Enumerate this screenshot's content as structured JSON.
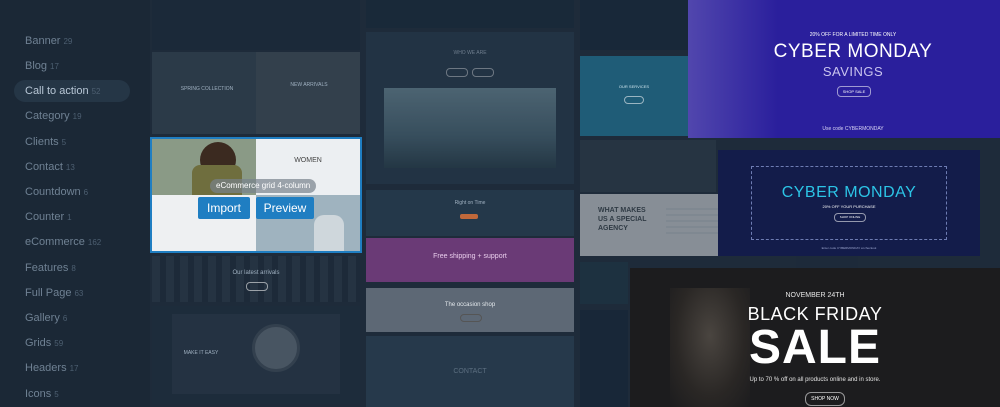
{
  "sidebar": {
    "items": [
      {
        "label": "",
        "count": ""
      },
      {
        "label": "Banner",
        "count": "29"
      },
      {
        "label": "Blog",
        "count": "17"
      },
      {
        "label": "Call to action",
        "count": "52"
      },
      {
        "label": "Category",
        "count": "19"
      },
      {
        "label": "Clients",
        "count": "5"
      },
      {
        "label": "Contact",
        "count": "13"
      },
      {
        "label": "Countdown",
        "count": "6"
      },
      {
        "label": "Counter",
        "count": "1"
      },
      {
        "label": "eCommerce",
        "count": "162"
      },
      {
        "label": "Features",
        "count": "8"
      },
      {
        "label": "Full Page",
        "count": "63"
      },
      {
        "label": "Gallery",
        "count": "6"
      },
      {
        "label": "Grids",
        "count": "59"
      },
      {
        "label": "Headers",
        "count": "17"
      },
      {
        "label": "Icons",
        "count": "5"
      }
    ]
  },
  "templates": {
    "spring": {
      "left": "SPRING COLLECTION",
      "right": "NEW ARRIVALS"
    },
    "who": {
      "title": "WHO WE ARE"
    },
    "services": {
      "title": "OUR SERVICES"
    },
    "ecom_grid": {
      "caption": "eCommerce grid 4-column",
      "women": "WOMEN",
      "import": "Import",
      "preview": "Preview"
    },
    "right_on_time": "Right on Time",
    "free_shipping": "Free shipping + support",
    "arrivals": "Our latest arrivals",
    "occasion": "The occasion shop",
    "make_easy": "MAKE IT EASY",
    "contact": "CONTACT",
    "agency": "WHAT MAKES US A SPECIAL AGENCY",
    "cyber1": {
      "top": "20% OFF FOR A LIMITED TIME ONLY",
      "title": "CYBER MONDAY",
      "sub": "SAVINGS",
      "btn": "SHOP SALE",
      "code": "Use code CYBERMONDAY"
    },
    "cyber2": {
      "title": "CYBER MONDAY",
      "sub": "20% OFF YOUR PURCHASE",
      "btn": "SHOP ONLINE",
      "code": "Enter code CYBERMONDAY at checkout"
    },
    "black_friday": {
      "date": "NOVEMBER 24TH",
      "title": "BLACK FRIDAY",
      "sale": "SALE",
      "desc": "Up to 70 % off on all products online and in store.",
      "btn": "SHOP NOW"
    }
  },
  "colors": {
    "accent_blue": "#1f7ec2",
    "cyber_purple": "#2a1f9c",
    "cyber_cyan": "#2cc4e6",
    "magenta": "#9a4a9e"
  }
}
